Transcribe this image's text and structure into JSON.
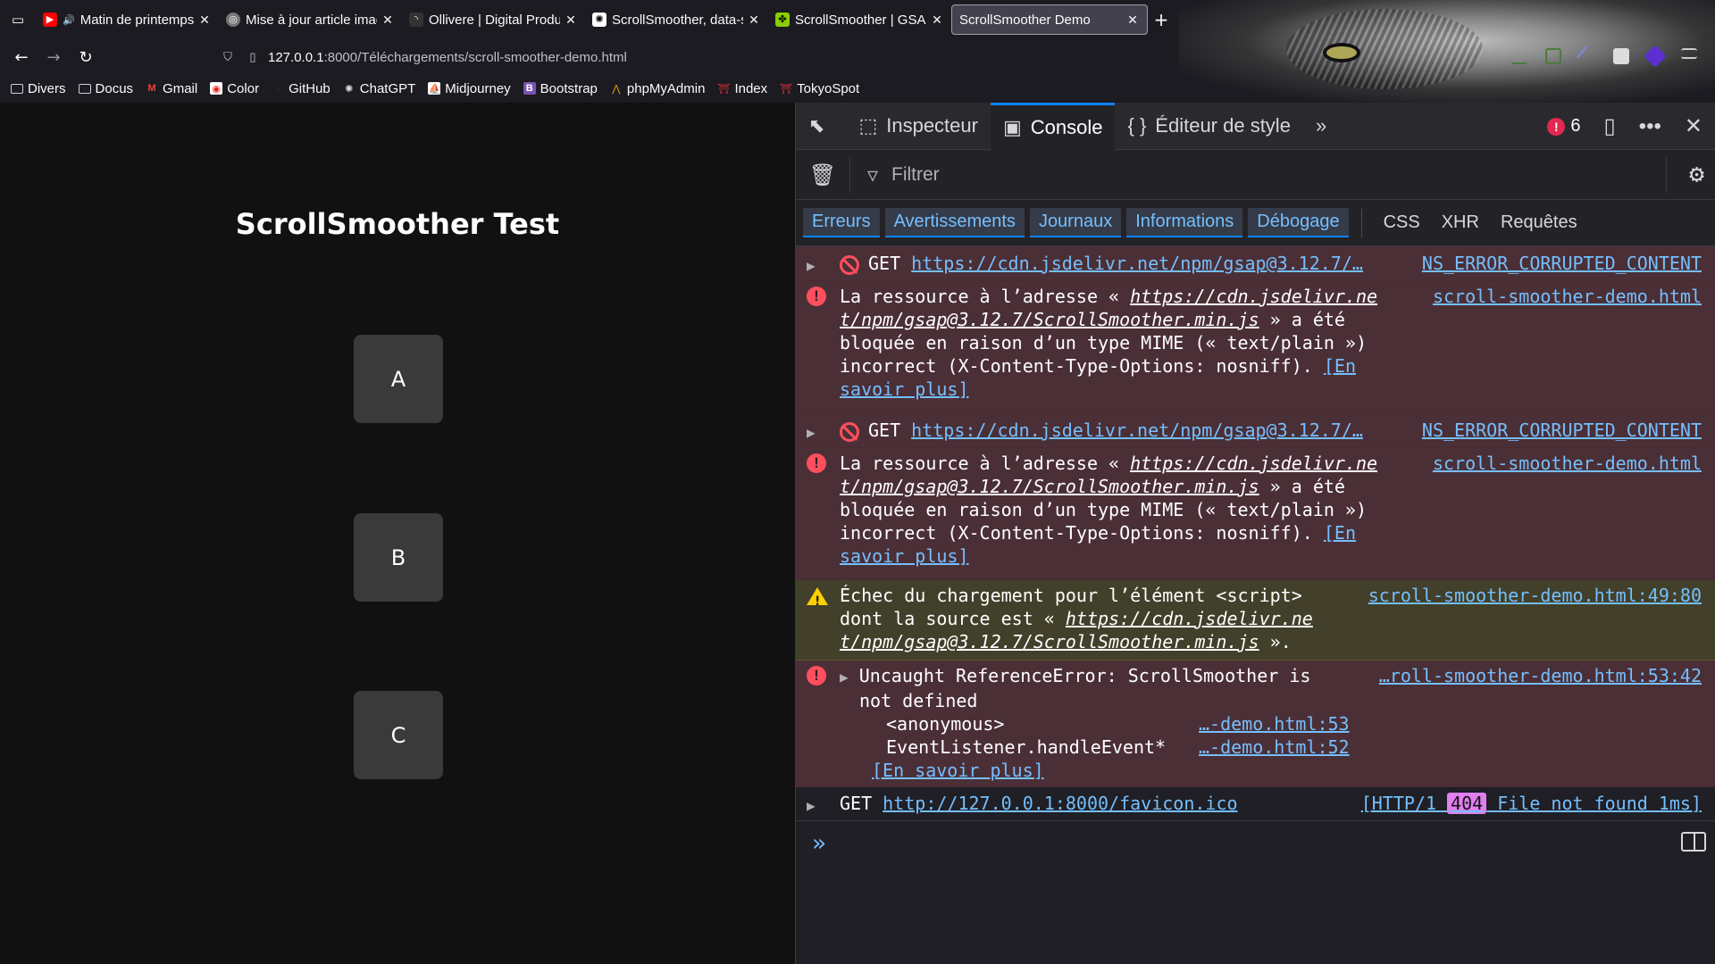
{
  "browser": {
    "tabs": [
      {
        "label": "Matin de printemps vi",
        "favicon_color": "#ff0000",
        "speaker": "🔊"
      },
      {
        "label": "Mise à jour article image",
        "favicon_color": "#888888"
      },
      {
        "label": "Ollivere | Digital Product",
        "favicon_color": "#333333"
      },
      {
        "label": "ScrollSmoother, data-spe",
        "favicon_color": "#ffffff"
      },
      {
        "label": "ScrollSmoother | GSAP | D",
        "favicon_color": "#88ce02"
      },
      {
        "label": "ScrollSmoother Demo",
        "favicon_color": "#42414d"
      }
    ],
    "url": {
      "host": "127.0.0.1",
      "path": ":8000/Téléchargements/scroll-smoother-demo.html"
    },
    "bookmarks": [
      {
        "label": "Divers",
        "icon": "folder-icon"
      },
      {
        "label": "Docus",
        "icon": "folder-icon"
      },
      {
        "label": "Gmail",
        "icon": "gmail-icon"
      },
      {
        "label": "Color",
        "icon": "color-icon"
      },
      {
        "label": "GitHub",
        "icon": "github-icon"
      },
      {
        "label": "ChatGPT",
        "icon": "chatgpt-icon"
      },
      {
        "label": "Midjourney",
        "icon": "midjourney-icon"
      },
      {
        "label": "Bootstrap",
        "icon": "bootstrap-icon"
      },
      {
        "label": "phpMyAdmin",
        "icon": "phpmyadmin-icon"
      },
      {
        "label": "Index",
        "icon": "index-icon"
      },
      {
        "label": "TokyoSpot",
        "icon": "tokyospot-icon"
      }
    ]
  },
  "page": {
    "title": "ScrollSmoother Test",
    "boxes": [
      "A",
      "B",
      "C"
    ]
  },
  "devtools": {
    "tabs": {
      "inspector": "Inspecteur",
      "console": "Console",
      "style_editor": "Éditeur de style"
    },
    "error_count": "6",
    "filter_placeholder": "Filtrer",
    "levels": [
      "Erreurs",
      "Avertissements",
      "Journaux",
      "Informations",
      "Débogage"
    ],
    "extra_filters": [
      "CSS",
      "XHR",
      "Requêtes"
    ],
    "messages": {
      "get1": {
        "method": "GET",
        "url": "https://cdn.jsdelivr.net/npm/gsap@3.12.7/…",
        "status": "NS_ERROR_CORRUPTED_CONTENT"
      },
      "mime1": {
        "pre": "La ressource à l’adresse « ",
        "link1": "https://cdn.jsdelivr.ne",
        "link2": "t/npm/gsap@3.12.7/ScrollSmoother.min.js",
        "post1": " » a été",
        "line3": "bloquée en raison d’un type MIME (« text/plain »)",
        "line4": "incorrect (X-Content-Type-Options: nosniff). ",
        "more1": "[En",
        "more2": "savoir plus]",
        "source": "scroll-smoother-demo.html"
      },
      "get2": {
        "method": "GET",
        "url": "https://cdn.jsdelivr.net/npm/gsap@3.12.7/…",
        "status": "NS_ERROR_CORRUPTED_CONTENT"
      },
      "mime2": {
        "pre": "La ressource à l’adresse « ",
        "link1": "https://cdn.jsdelivr.ne",
        "link2": "t/npm/gsap@3.12.7/ScrollSmoother.min.js",
        "post1": " » a été",
        "line3": "bloquée en raison d’un type MIME (« text/plain »)",
        "line4": "incorrect (X-Content-Type-Options: nosniff). ",
        "more1": "[En",
        "more2": "savoir plus]",
        "source": "scroll-smoother-demo.html"
      },
      "warn": {
        "line1": "Échec du chargement pour l’élément <script>",
        "line2pre": "dont la source est « ",
        "link1": "https://cdn.jsdelivr.ne",
        "link2": "t/npm/gsap@3.12.7/ScrollSmoother.min.js",
        "post": " ».",
        "source": "scroll-smoother-demo.html:49:80"
      },
      "ref": {
        "line1": "Uncaught ReferenceError: ScrollSmoother is",
        "line2": "not defined",
        "stack": [
          {
            "fn": "<anonymous>",
            "loc": "…-demo.html:53"
          },
          {
            "fn": "EventListener.handleEvent*",
            "loc": "…-demo.html:52"
          }
        ],
        "more": "[En savoir plus]",
        "source": "…roll-smoother-demo.html:53:42"
      },
      "favicon": {
        "method": "GET",
        "url": "http://127.0.0.1:8000/favicon.ico",
        "pre": "[HTTP/1 ",
        "code": "404",
        "post": " File not found 1ms]"
      }
    },
    "prompt": "»"
  }
}
